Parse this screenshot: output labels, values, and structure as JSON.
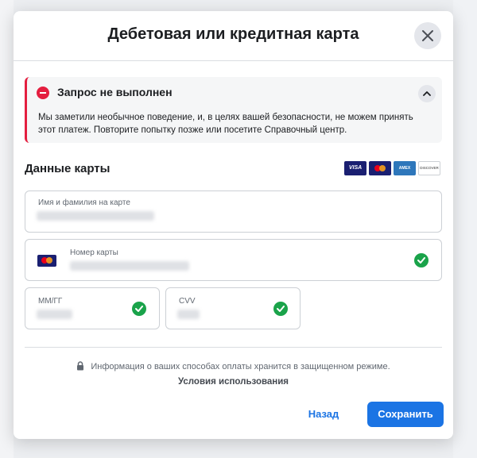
{
  "dialog": {
    "title": "Дебетовая или кредитная карта",
    "close_icon": "close-icon"
  },
  "alert": {
    "title": "Запрос не выполнен",
    "message": "Мы заметили необычное поведение, и, в целях вашей безопасности, не можем принять этот платеж. Повторите попытку позже или посетите Справочный центр.",
    "icon": "error-minus-icon",
    "accent_color": "#e41e3f"
  },
  "card_section": {
    "title": "Данные карты",
    "logos": [
      "VISA",
      "mastercard",
      "AMEX",
      "DISCOVER"
    ]
  },
  "fields": {
    "name": {
      "label": "Имя и фамилия на карте"
    },
    "number": {
      "label": "Номер карты",
      "valid": true
    },
    "expiry": {
      "label": "ММ/ГГ",
      "valid": true
    },
    "cvv": {
      "label": "CVV",
      "valid": true
    }
  },
  "footer": {
    "secure_text": "Информация о ваших способах оплаты хранится в защищенном режиме.",
    "terms_link": "Условия использования",
    "back_button": "Назад",
    "save_button": "Сохранить"
  },
  "colors": {
    "primary": "#1b74e4",
    "success": "#1aa34a",
    "error": "#e41e3f"
  }
}
